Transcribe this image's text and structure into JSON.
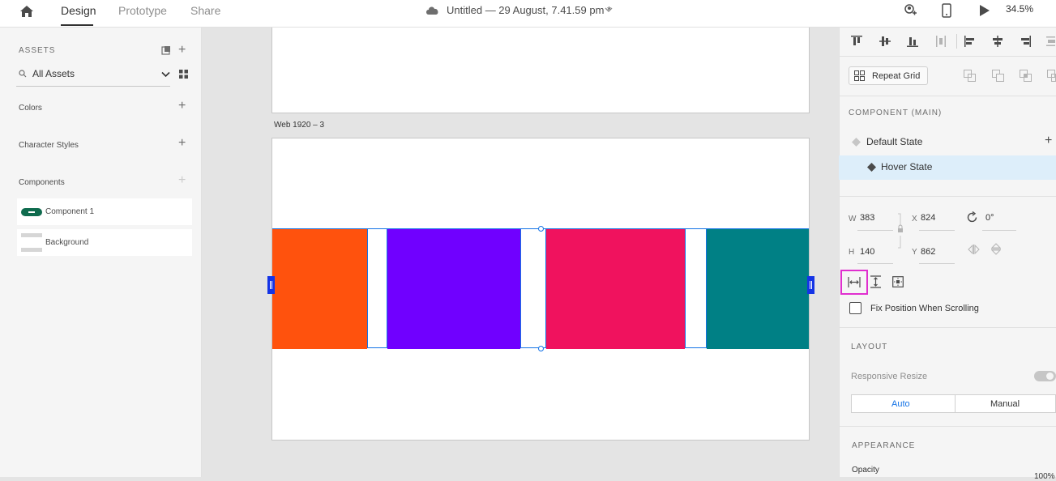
{
  "topbar": {
    "tabs": [
      "Design",
      "Prototype",
      "Share"
    ],
    "doc_title": "Untitled — 29 August, 7.41.59 pm *",
    "zoom": "34.5%"
  },
  "assets": {
    "heading": "ASSETS",
    "filter": "All Assets",
    "sections": [
      "Colors",
      "Character Styles",
      "Components"
    ],
    "components": [
      {
        "name": "Component 1"
      },
      {
        "name": "Background"
      }
    ]
  },
  "canvas": {
    "artboard_label": "Web 1920 – 3",
    "colors": {
      "orange": "#ff520d",
      "purple": "#7000ff",
      "pink": "#f0125e",
      "teal": "#008085",
      "selection": "#1473e6"
    }
  },
  "props": {
    "repeat_grid": "Repeat Grid",
    "component_heading": "COMPONENT (MAIN)",
    "default_state": "Default State",
    "hover_state": "Hover State",
    "w_label": "W",
    "w": "383",
    "x_label": "X",
    "x": "824",
    "h_label": "H",
    "h": "140",
    "y_label": "Y",
    "y": "862",
    "rotation": "0°",
    "fix_position": "Fix Position When Scrolling",
    "layout_heading": "LAYOUT",
    "responsive_resize": "Responsive Resize",
    "auto": "Auto",
    "manual": "Manual",
    "appearance_heading": "APPEARANCE",
    "opacity_label": "Opacity",
    "opacity_value": "100%"
  }
}
